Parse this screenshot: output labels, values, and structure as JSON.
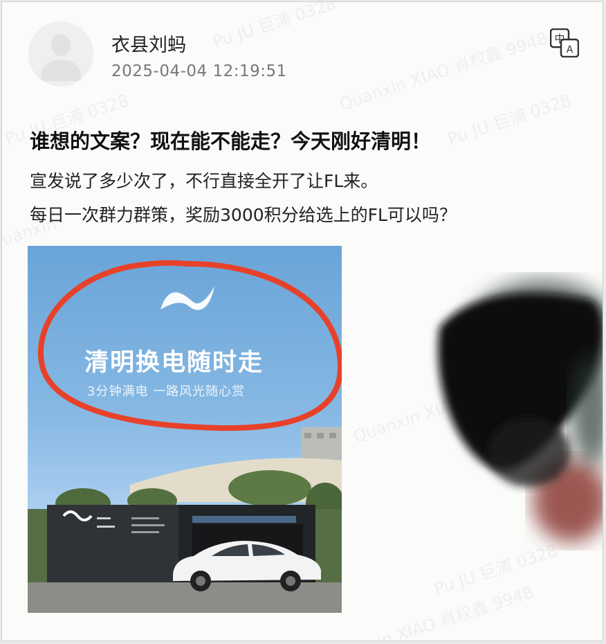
{
  "post": {
    "username": "衣县刘蚂",
    "timestamp": "2025-04-04 12:19:51",
    "title": "谁想的文案？现在能不能走？今天刚好清明！",
    "body_lines": [
      "宣发说了多少次了，不行直接全开了让FL来。",
      "每日一次群力群策，奖励3000积分给选上的FL可以吗？"
    ]
  },
  "translate_icon": {
    "top_glyph": "中",
    "bottom_glyph": "A"
  },
  "image": {
    "headline": "清明换电随时走",
    "subline": "3分钟满电 一路风光随心赏"
  },
  "watermarks": [
    "Quanxin XIAO 肖权鑫 9948",
    "Pu JU 巨浦 0328",
    "Quanxin XIAO 肖权鑫 9948",
    "Pu JU 巨浦 0328",
    "Quanxin",
    "Pu JU 巨浦 0328",
    "Quanxin XIAO 肖权鑫 9948",
    "Pu JU 巨浦 0328"
  ],
  "colors": {
    "circle": "#e8412a",
    "sky": "#7fb3e0"
  }
}
